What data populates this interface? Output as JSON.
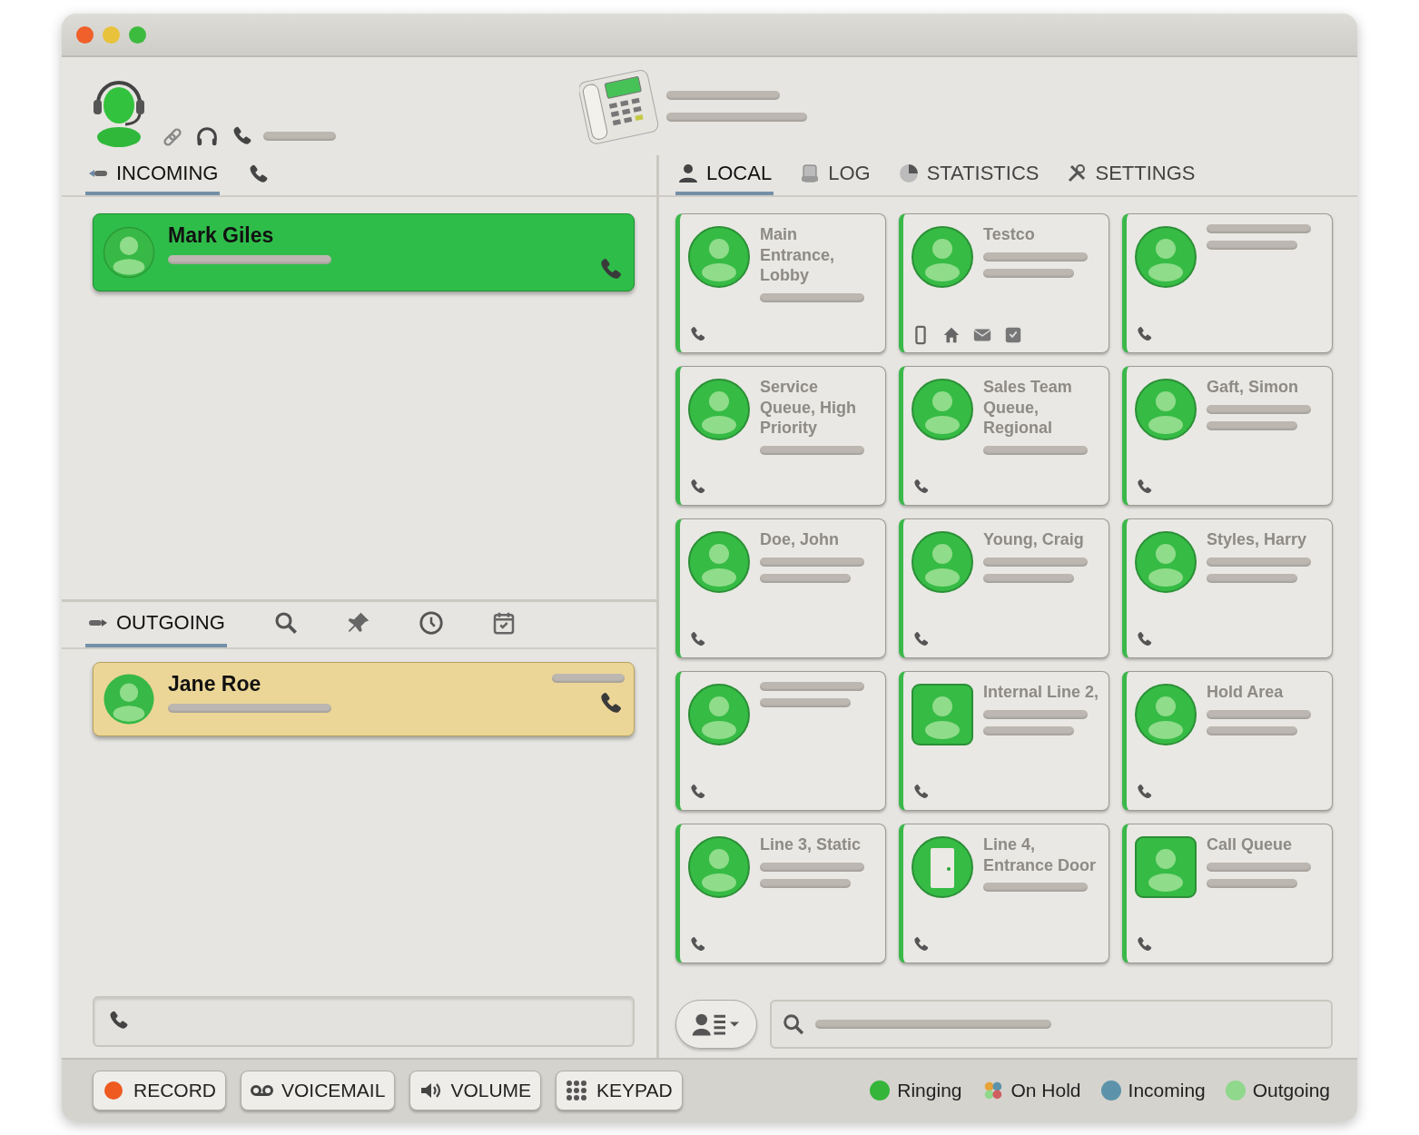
{
  "incoming": {
    "tab": {
      "label": "INCOMING",
      "selected": true
    },
    "calls": [
      {
        "name": "Mark Giles"
      }
    ]
  },
  "outgoing": {
    "tabs": [
      {
        "kind": "label",
        "label": "OUTGOING",
        "selected": true
      },
      {
        "kind": "search",
        "selected": false
      },
      {
        "kind": "pin",
        "selected": false
      },
      {
        "kind": "clock",
        "selected": false
      },
      {
        "kind": "calendar",
        "selected": false
      }
    ],
    "calls": [
      {
        "name": "Jane Roe"
      }
    ]
  },
  "directory_tabs": [
    {
      "kind": "person",
      "label": "LOCAL",
      "selected": true
    },
    {
      "kind": "log",
      "label": "LOG",
      "selected": false
    },
    {
      "kind": "pie",
      "label": "STATISTICS",
      "selected": false
    },
    {
      "kind": "tools",
      "label": "SETTINGS",
      "selected": false
    }
  ],
  "contacts": [
    {
      "kind": "circle",
      "name": "Main Entrance, Lobby",
      "actions": [
        {
          "kind": "phone"
        }
      ]
    },
    {
      "kind": "circle",
      "name": "Testco",
      "actions": [
        {
          "kind": "mobile"
        },
        {
          "kind": "home"
        },
        {
          "kind": "mail"
        },
        {
          "kind": "message"
        }
      ]
    },
    {
      "kind": "circle",
      "actions": [
        {
          "kind": "phone"
        }
      ]
    },
    {
      "kind": "circle",
      "name": "Service Queue, High Priority",
      "actions": [
        {
          "kind": "phone"
        }
      ]
    },
    {
      "kind": "circle",
      "name": "Sales Team Queue, Regional",
      "actions": [
        {
          "kind": "phone"
        }
      ]
    },
    {
      "kind": "circle",
      "name": "Gaft, Simon",
      "actions": [
        {
          "kind": "phone"
        }
      ]
    },
    {
      "kind": "circle",
      "name": "Doe, John",
      "actions": [
        {
          "kind": "phone"
        }
      ]
    },
    {
      "kind": "circle",
      "name": "Young, Craig",
      "actions": [
        {
          "kind": "phone"
        }
      ]
    },
    {
      "kind": "circle",
      "name": "Styles, Harry",
      "actions": [
        {
          "kind": "phone"
        }
      ]
    },
    {
      "kind": "circle",
      "actions": [
        {
          "kind": "phone"
        }
      ]
    },
    {
      "kind": "square",
      "name": "Internal Line 2,",
      "actions": [
        {
          "kind": "phone"
        }
      ]
    },
    {
      "kind": "circle",
      "name": "Hold Area",
      "actions": [
        {
          "kind": "phone"
        }
      ]
    },
    {
      "kind": "circle",
      "name": "Line 3, Static",
      "actions": [
        {
          "kind": "phone"
        }
      ]
    },
    {
      "kind": "door",
      "name": "Line 4, Entrance Door",
      "actions": [
        {
          "kind": "phone"
        }
      ]
    },
    {
      "kind": "square",
      "name": "Call Queue",
      "actions": [
        {
          "kind": "phone"
        }
      ]
    }
  ],
  "buttons": [
    {
      "kind": "record",
      "label": "RECORD"
    },
    {
      "kind": "voicemail",
      "label": "VOICEMAIL"
    },
    {
      "kind": "volume",
      "label": "VOLUME"
    },
    {
      "kind": "keypad",
      "label": "KEYPAD"
    }
  ],
  "legend": [
    {
      "kind": "dot",
      "label": "Ringing",
      "color": "#35b53a"
    },
    {
      "kind": "cluster",
      "label": "On Hold"
    },
    {
      "kind": "dot",
      "label": "Incoming",
      "color": "#5c93aa"
    },
    {
      "kind": "dot",
      "label": "Outgoing",
      "color": "#8fd88c"
    }
  ]
}
